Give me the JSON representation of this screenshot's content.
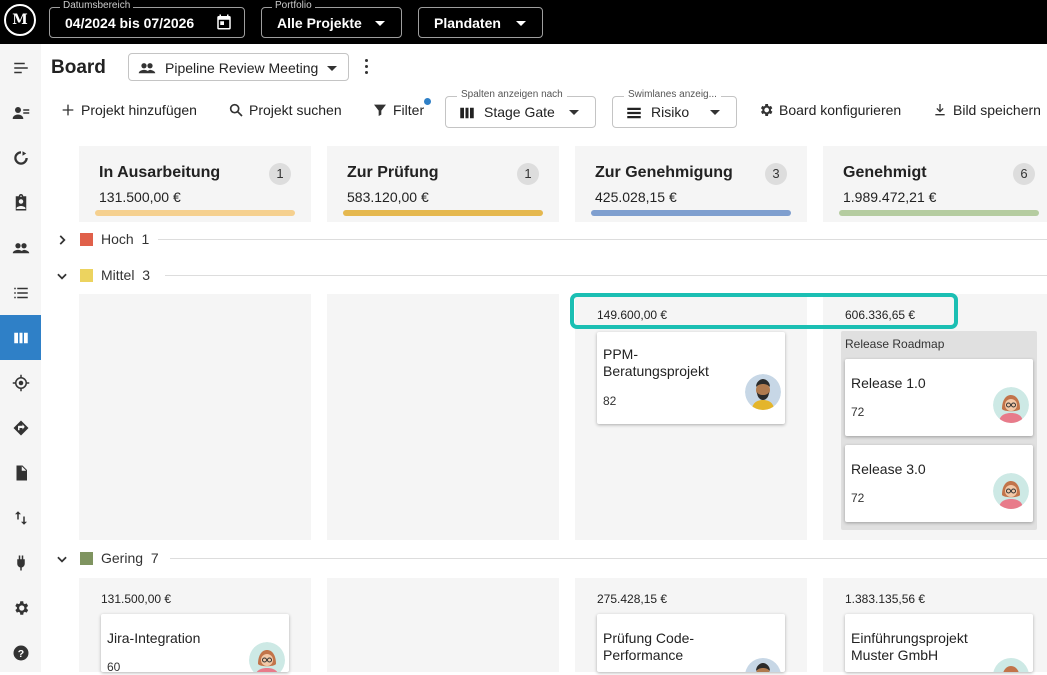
{
  "topbar": {
    "date_range": {
      "label": "Datumsbereich",
      "value": "04/2024 bis 07/2026"
    },
    "portfolio": {
      "label": "Portfolio",
      "value": "Alle Projekte"
    },
    "plandaten": "Plandaten"
  },
  "header": {
    "title": "Board",
    "meeting_select": "Pipeline Review Meeting"
  },
  "toolbar": {
    "add_project": "Projekt hinzufügen",
    "search_project": "Projekt suchen",
    "filter": "Filter",
    "columns_select": {
      "label": "Spalten anzeigen nach",
      "value": "Stage Gate"
    },
    "swimlanes_select": {
      "label": "Swimlanes anzeig...",
      "value": "Risiko"
    },
    "configure": "Board konfigurieren",
    "save_image": "Bild speichern"
  },
  "columns": [
    {
      "title": "In Ausarbeitung",
      "sum": "131.500,00 €",
      "count": "1",
      "color": "#f5d08f"
    },
    {
      "title": "Zur Prüfung",
      "sum": "583.120,00 €",
      "count": "1",
      "color": "#e5b84f"
    },
    {
      "title": "Zur Genehmigung",
      "sum": "425.028,15 €",
      "count": "3",
      "color": "#7f9fcf"
    },
    {
      "title": "Genehmigt",
      "sum": "1.989.472,21 €",
      "count": "6",
      "color": "#b5cca0"
    }
  ],
  "swimlanes": [
    {
      "name": "Hoch",
      "count": "1",
      "color": "#e0604a",
      "expanded": false
    },
    {
      "name": "Mittel",
      "count": "3",
      "color": "#ecd35f",
      "expanded": true
    },
    {
      "name": "Gering",
      "count": "7",
      "color": "#7f9460",
      "expanded": true
    }
  ],
  "mittel": {
    "col3_sum": "149.600,00 €",
    "col4_sum": "606.336,65 €",
    "card_ppm": {
      "title": "PPM-Beratungsprojekt",
      "score": "82"
    },
    "group": {
      "title": "Release Roadmap",
      "cards": [
        {
          "title": "Release 1.0",
          "score": "72"
        },
        {
          "title": "Release 3.0",
          "score": "72"
        }
      ]
    }
  },
  "gering": {
    "col1_sum": "131.500,00 €",
    "col3_sum": "275.428,15 €",
    "col4_sum": "1.383.135,56 €",
    "card_jira": {
      "title": "Jira-Integration",
      "score": "60"
    },
    "card_code": {
      "title": "Prüfung Code-Performance"
    },
    "card_muster": {
      "title": "Einführungsprojekt Muster GmbH"
    }
  },
  "colors": {
    "accent": "#2f80c7",
    "highlight": "#1bbfb3"
  }
}
